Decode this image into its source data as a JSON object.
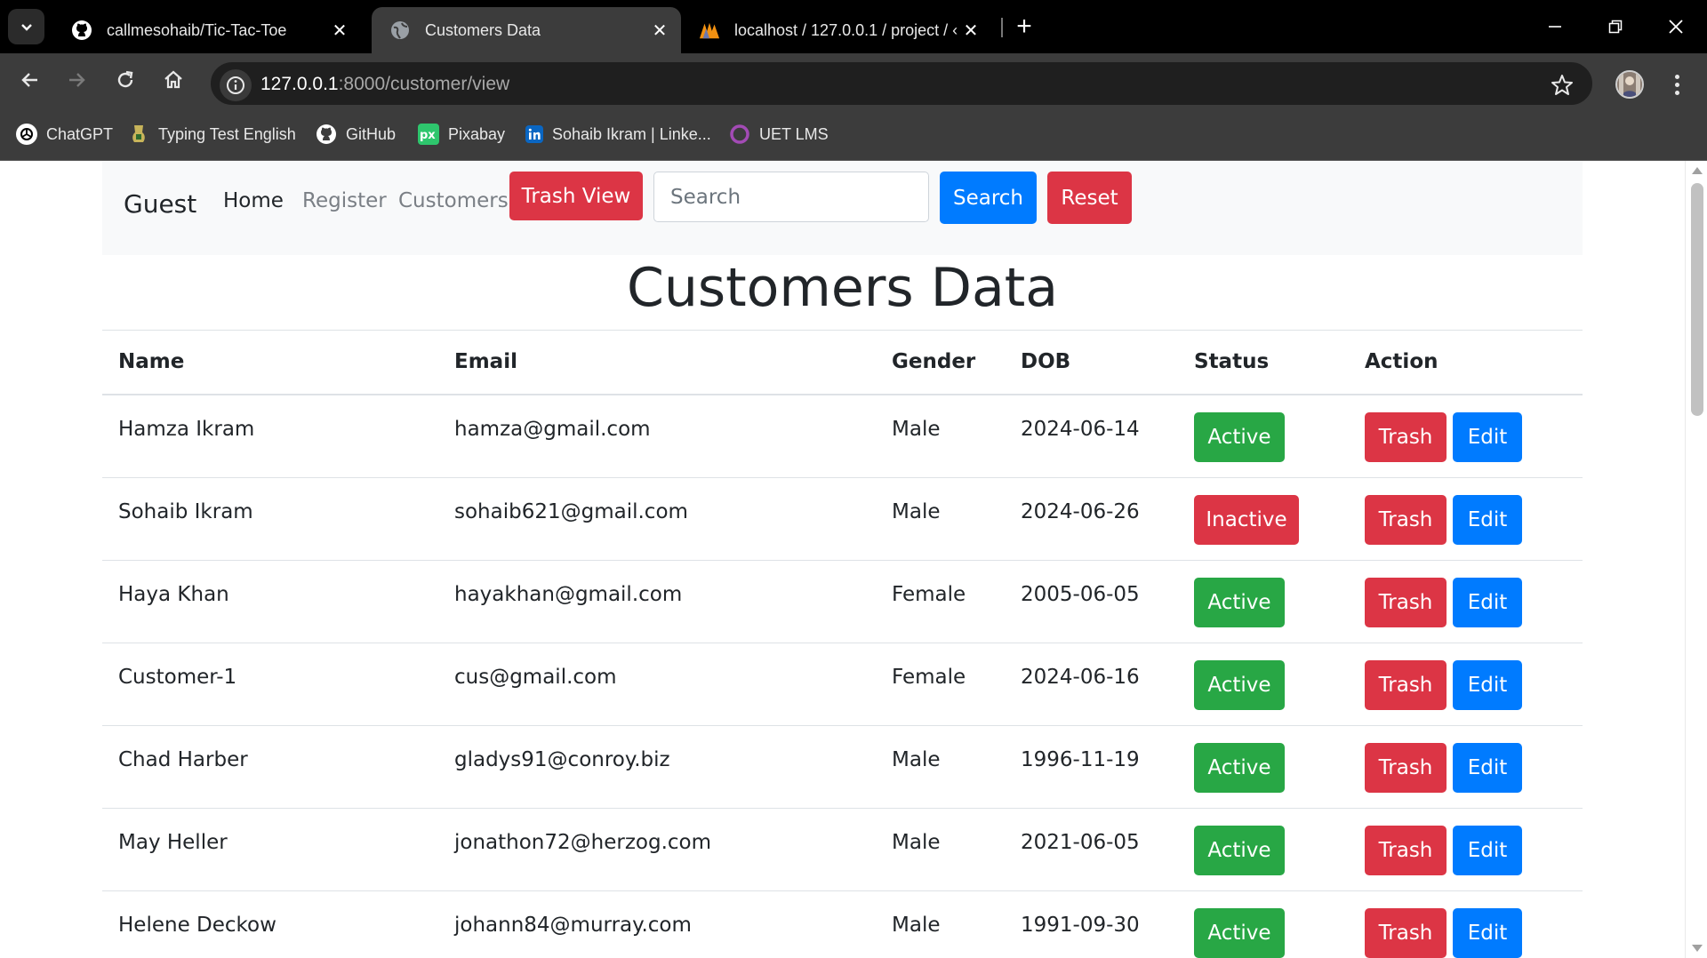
{
  "browser": {
    "tabs": [
      {
        "title": "callmesohaib/Tic-Tac-Toe",
        "icon": "github-icon",
        "active": false
      },
      {
        "title": "Customers Data",
        "icon": "globe-icon",
        "active": true
      },
      {
        "title": "localhost / 127.0.0.1 / project / ‹",
        "icon": "phpmyadmin-icon",
        "active": false
      }
    ],
    "url_host": "127.0.0.1",
    "url_path": ":8000/customer/view",
    "bookmarks": [
      {
        "label": "ChatGPT",
        "icon": "chatgpt-icon"
      },
      {
        "label": "Typing Test English",
        "icon": "typing-test-icon"
      },
      {
        "label": "GitHub",
        "icon": "github-icon"
      },
      {
        "label": "Pixabay",
        "icon": "pixabay-icon"
      },
      {
        "label": "Sohaib Ikram | Linke...",
        "icon": "linkedin-icon"
      },
      {
        "label": "UET LMS",
        "icon": "uet-lms-icon"
      }
    ]
  },
  "navbar": {
    "brand": "Guest",
    "links": [
      "Home",
      "Register",
      "Customers"
    ],
    "trash_view": "Trash View",
    "search_placeholder": "Search",
    "search_button": "Search",
    "reset_button": "Reset"
  },
  "page": {
    "heading": "Customers Data"
  },
  "table": {
    "headers": [
      "Name",
      "Email",
      "Gender",
      "DOB",
      "Status",
      "Action"
    ],
    "trash_label": "Trash",
    "edit_label": "Edit",
    "rows": [
      {
        "name": "Hamza Ikram",
        "email": "hamza@gmail.com",
        "gender": "Male",
        "dob": "2024-06-14",
        "status": "Active"
      },
      {
        "name": "Sohaib Ikram",
        "email": "sohaib621@gmail.com",
        "gender": "Male",
        "dob": "2024-06-26",
        "status": "Inactive"
      },
      {
        "name": "Haya Khan",
        "email": "hayakhan@gmail.com",
        "gender": "Female",
        "dob": "2005-06-05",
        "status": "Active"
      },
      {
        "name": "Customer-1",
        "email": "cus@gmail.com",
        "gender": "Female",
        "dob": "2024-06-16",
        "status": "Active"
      },
      {
        "name": "Chad Harber",
        "email": "gladys91@conroy.biz",
        "gender": "Male",
        "dob": "1996-11-19",
        "status": "Active"
      },
      {
        "name": "May Heller",
        "email": "jonathon72@herzog.com",
        "gender": "Male",
        "dob": "2021-06-05",
        "status": "Active"
      },
      {
        "name": "Helene Deckow",
        "email": "johann84@murray.com",
        "gender": "Male",
        "dob": "1991-09-30",
        "status": "Active"
      }
    ]
  },
  "colors": {
    "success": "#28a745",
    "danger": "#dc3545",
    "primary": "#007bff",
    "chrome_dark": "#3c3c3c"
  }
}
